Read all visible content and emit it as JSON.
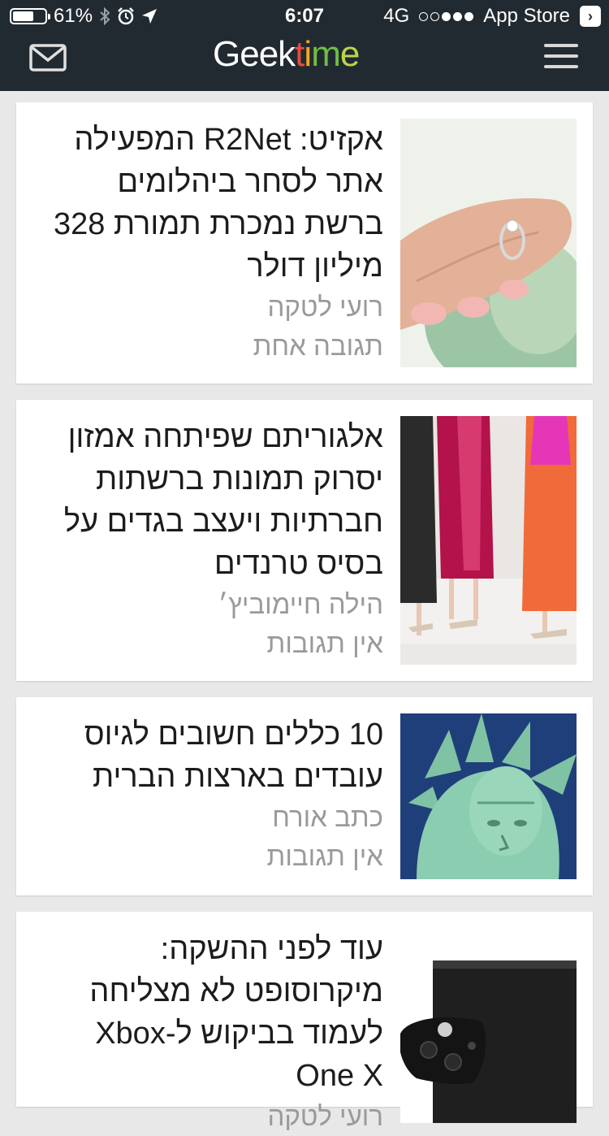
{
  "status": {
    "battery": "61%",
    "time": "6:07",
    "network": "4G",
    "back_app": "App Store",
    "back_icon": "chevron-right-icon"
  },
  "header": {
    "logo": {
      "part1": "Geek",
      "t": "t",
      "i": "i",
      "m": "m",
      "e": "e"
    },
    "mail_icon": "mail-icon",
    "menu_icon": "hamburger-menu-icon",
    "bg_color": "#222a31"
  },
  "articles": [
    {
      "title": "אקזיט: R2Net המפעילה אתר לסחר ביהלומים ברשת נמכרת תמורת 328 מיליון דולר",
      "author": "רועי לטקה",
      "comments": "תגובה אחת",
      "image": "ring-photo"
    },
    {
      "title": "אלגוריתם שפיתחה אמזון יסרוק תמונות ברשתות חברתיות ויעצב בגדים על בסיס טרנדים",
      "author": "הילה חיימוביץ׳",
      "comments": "אין תגובות",
      "image": "fashion-photo"
    },
    {
      "title": "10 כללים חשובים לגיוס עובדים בארצות הברית",
      "author": "כתב אורח",
      "comments": "אין תגובות",
      "image": "statue-of-liberty-photo"
    },
    {
      "title": "עוד לפני ההשקה: מיקרוסופט לא מצליחה לעמוד בביקוש ל-Xbox One X",
      "author": "רועי לטקה",
      "comments": "",
      "image": "xbox-photo"
    }
  ]
}
